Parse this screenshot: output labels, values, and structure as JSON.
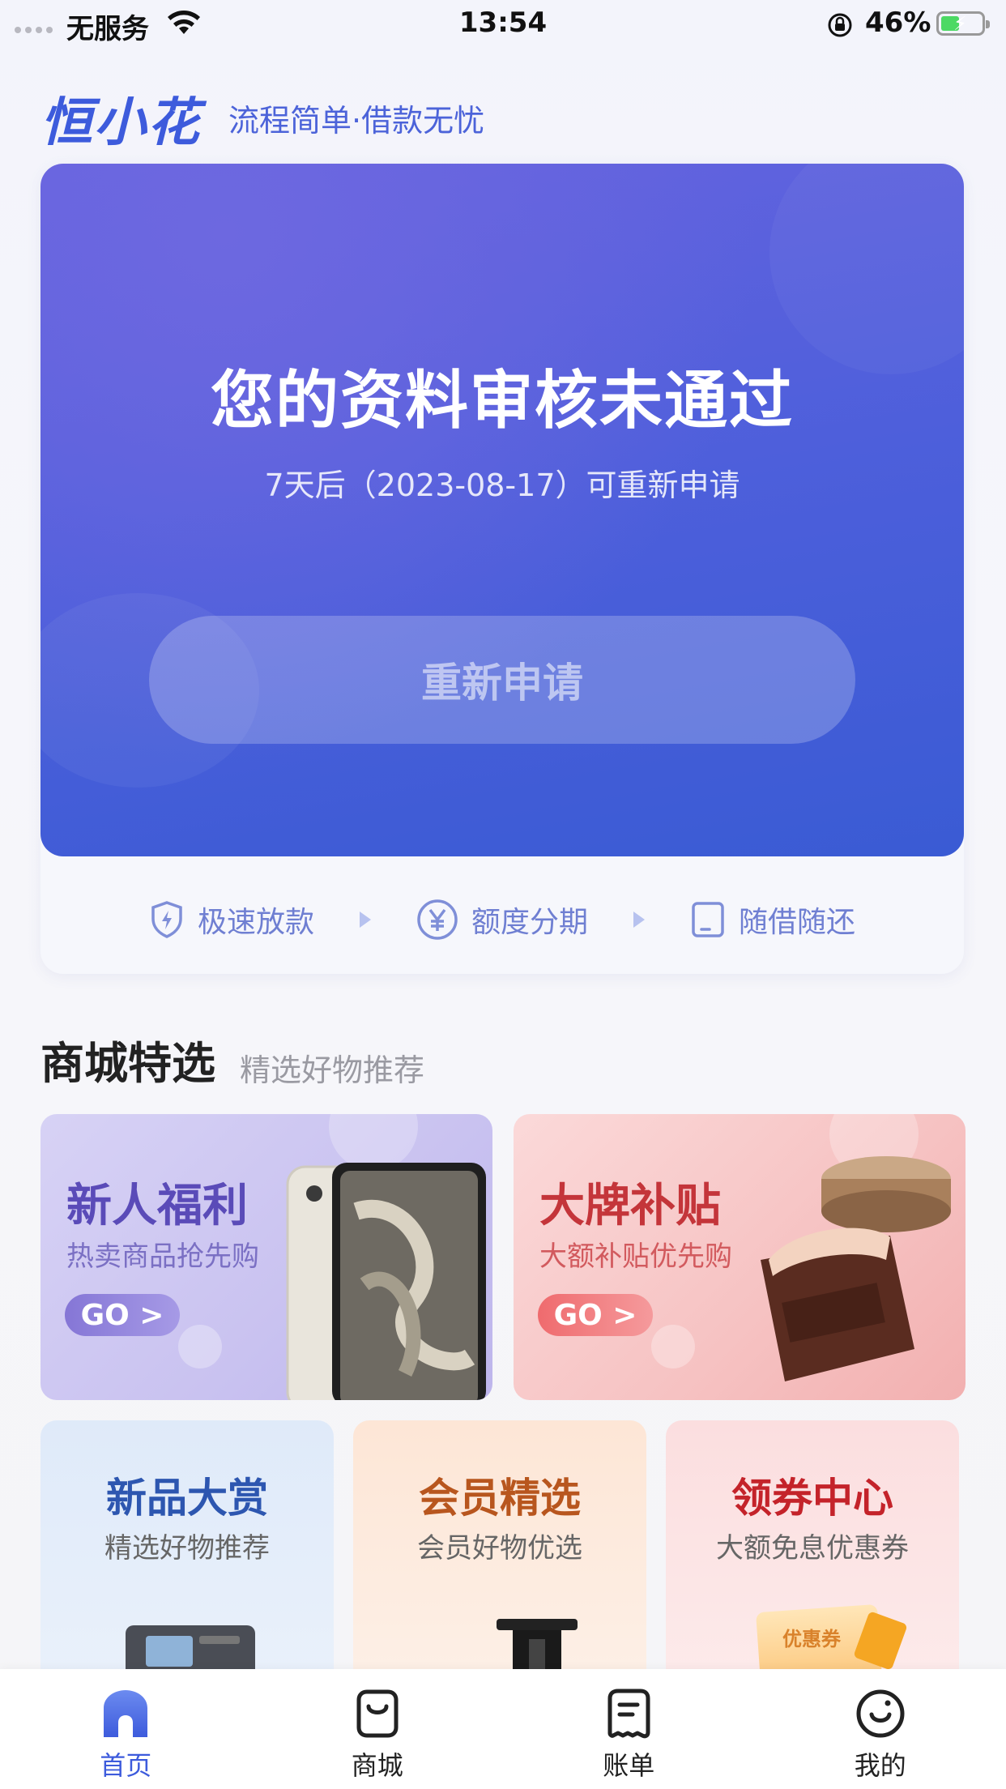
{
  "status_bar": {
    "carrier": "无服务",
    "time": "13:54",
    "battery_percent": "46%",
    "battery_level": 0.46
  },
  "header": {
    "logo": "恒小花",
    "slogan": "流程简单·借款无忧"
  },
  "hero": {
    "title": "您的资料审核未通过",
    "subtitle": "7天后（2023-08-17）可重新申请",
    "button_label": "重新申请"
  },
  "features": [
    {
      "label": "极速放款",
      "icon": "shield-lightning-icon"
    },
    {
      "label": "额度分期",
      "icon": "yuan-circle-icon"
    },
    {
      "label": "随借随还",
      "icon": "phone-icon"
    }
  ],
  "mall_section": {
    "title": "商城特选",
    "subtitle": "精选好物推荐"
  },
  "promo_cards": [
    {
      "title": "新人福利",
      "subtitle": "热卖商品抢先购",
      "button": "GO >",
      "color": "#5a4bb8"
    },
    {
      "title": "大牌补贴",
      "subtitle": "大额补贴优先购",
      "button": "GO >",
      "color": "#c4353a"
    }
  ],
  "category_cards": [
    {
      "title": "新品大赏",
      "subtitle": "精选好物推荐",
      "color": "#2d56b0"
    },
    {
      "title": "会员精选",
      "subtitle": "会员好物优选",
      "color": "#b8561e"
    },
    {
      "title": "领券中心",
      "subtitle": "大额免息优惠券",
      "color": "#c4232a"
    }
  ],
  "coupon_label": "优惠券",
  "tabbar": [
    {
      "label": "首页",
      "icon": "home-icon",
      "active": true
    },
    {
      "label": "商城",
      "icon": "shopping-bag-icon",
      "active": false
    },
    {
      "label": "账单",
      "icon": "bill-icon",
      "active": false
    },
    {
      "label": "我的",
      "icon": "smiley-icon",
      "active": false
    }
  ],
  "colors": {
    "brand": "#3d5bdc",
    "hero_gradient_start": "#6663df",
    "hero_gradient_end": "#3a5bd4"
  }
}
